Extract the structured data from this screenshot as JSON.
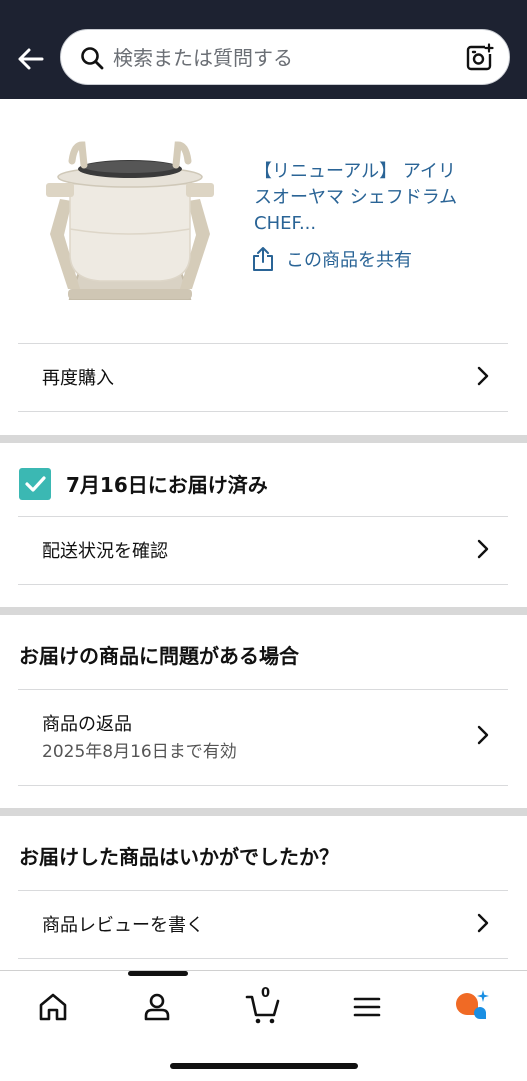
{
  "search": {
    "placeholder": "検索または質問する"
  },
  "product": {
    "title_line1": "【リニューアル】 アイリ",
    "title_line2": "スオーヤマ シェフドラム",
    "title_line3": "CHEF...",
    "share_label": "この商品を共有"
  },
  "rebuy": {
    "label": "再度購入"
  },
  "delivery": {
    "status": "7月16日にお届け済み",
    "track_label": "配送状況を確認"
  },
  "problem": {
    "heading": "お届けの商品に問題がある場合",
    "return_label": "商品の返品",
    "return_deadline": "2025年8月16日まで有効"
  },
  "review": {
    "heading": "お届けした商品はいかがでしたか？",
    "write_label": "商品レビューを書く"
  },
  "nav": {
    "cart_count": "0"
  },
  "colors": {
    "header_bg": "#1d2231",
    "link": "#2a6496",
    "check": "#3bb8b3",
    "ai_orange": "#f06a25",
    "ai_blue": "#1a8fe3"
  }
}
